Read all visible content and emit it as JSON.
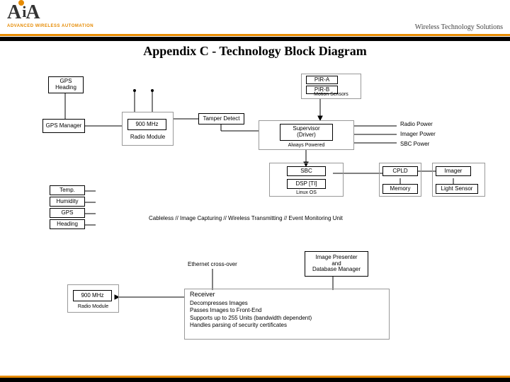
{
  "header": {
    "logo_text": "A A",
    "logo_sub": "ADVANCED WIRELESS AUTOMATION",
    "tagline": "Wireless Technology Solutions"
  },
  "title": "Appendix C - Technology Block Diagram",
  "blocks": {
    "gps_heading": "GPS\nHeading",
    "gps_manager": "GPS Manager",
    "nine00_1": "900 MHz",
    "radio_module_1": "Radio Module",
    "tamper": "Tamper Detect",
    "pir_a": "PIR-A",
    "pir_b": "PIR-B",
    "motion_sensors": "Motion Sensors",
    "supervisor": "Supervisor\n(Driver)",
    "always_powered": "Always Powered",
    "radio_power": "Radio Power",
    "imager_power": "Imager Power",
    "sbc_power": "SBC Power",
    "sbc": "SBC",
    "dsp": "DSP [TI]",
    "linux_os": "Linux OS",
    "cpld": "CPLD",
    "memory": "Memory",
    "imager": "Imager",
    "light_sensor": "Light Sensor",
    "temp": "Temp.",
    "humidity": "Humidity",
    "gps": "GPS",
    "heading2": "Heading",
    "caption_unit": "Cableless // Image Capturing // Wireless Transmitting // Event Monitoring Unit",
    "ethernet": "Ethernet cross-over",
    "nine00_2": "900 MHz",
    "radio_module_2": "Radio Module",
    "presenter": "Image Presenter\nand\nDatabase Manager",
    "receiver_title": "Receiver",
    "receiver_lines": "Decompresses Images\nPasses Images to Front-End\nSupports up to 255 Units (bandwidth dependent)\nHandles parsing of security certificates"
  }
}
